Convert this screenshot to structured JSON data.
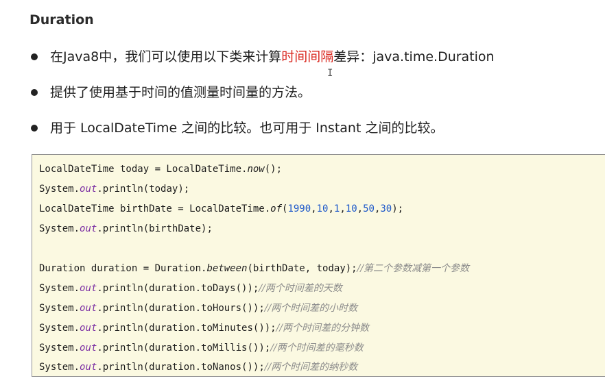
{
  "heading": "Duration",
  "bullets": [
    {
      "before": "在Java8中，我们可以使用以下类来计算",
      "highlight": "时间间隔",
      "after": "差异：java.time.Duration"
    },
    {
      "text": "提供了使用基于时间的值测量时间量的方法。"
    },
    {
      "text": "用于 LocalDateTime 之间的比较。也可用于 Instant 之间的比较。"
    }
  ],
  "cursor_glyph": "I",
  "code": {
    "l1": {
      "a": "LocalDateTime today = LocalDateTime.",
      "m": "now",
      "b": "();"
    },
    "l2": {
      "a": "System.",
      "f": "out",
      "b": ".println(today);"
    },
    "l3": {
      "a": "LocalDateTime birthDate = LocalDateTime.",
      "m": "of",
      "p": "(",
      "n1": "1990",
      "c1": ",",
      "n2": "10",
      "c2": ",",
      "n3": "1",
      "c3": ",",
      "n4": "10",
      "c4": ",",
      "n5": "50",
      "c5": ",",
      "n6": "30",
      "b": ");"
    },
    "l4": {
      "a": "System.",
      "f": "out",
      "b": ".println(birthDate);"
    },
    "l5": {
      "a": "Duration duration = Duration.",
      "m": "between",
      "b": "(birthDate, today);",
      "c": "//第二个参数减第一个参数"
    },
    "l6": {
      "a": "System.",
      "f": "out",
      "b": ".println(duration.toDays());",
      "c": "//两个时间差的天数"
    },
    "l7": {
      "a": "System.",
      "f": "out",
      "b": ".println(duration.toHours());",
      "c": "//两个时间差的小时数"
    },
    "l8": {
      "a": "System.",
      "f": "out",
      "b": ".println(duration.toMinutes());",
      "c": "//两个时间差的分钟数"
    },
    "l9": {
      "a": "System.",
      "f": "out",
      "b": ".println(duration.toMillis());",
      "c": "//两个时间差的毫秒数"
    },
    "l10": {
      "a": "System.",
      "f": "out",
      "b": ".println(duration.toNanos());",
      "c": "//两个时间差的纳秒数"
    }
  },
  "colors": {
    "highlight": "#d9251c",
    "code_background": "#fbf9e1",
    "number": "#1a56c9",
    "static_field": "#7b2fa3",
    "comment": "#8a8a8a"
  }
}
